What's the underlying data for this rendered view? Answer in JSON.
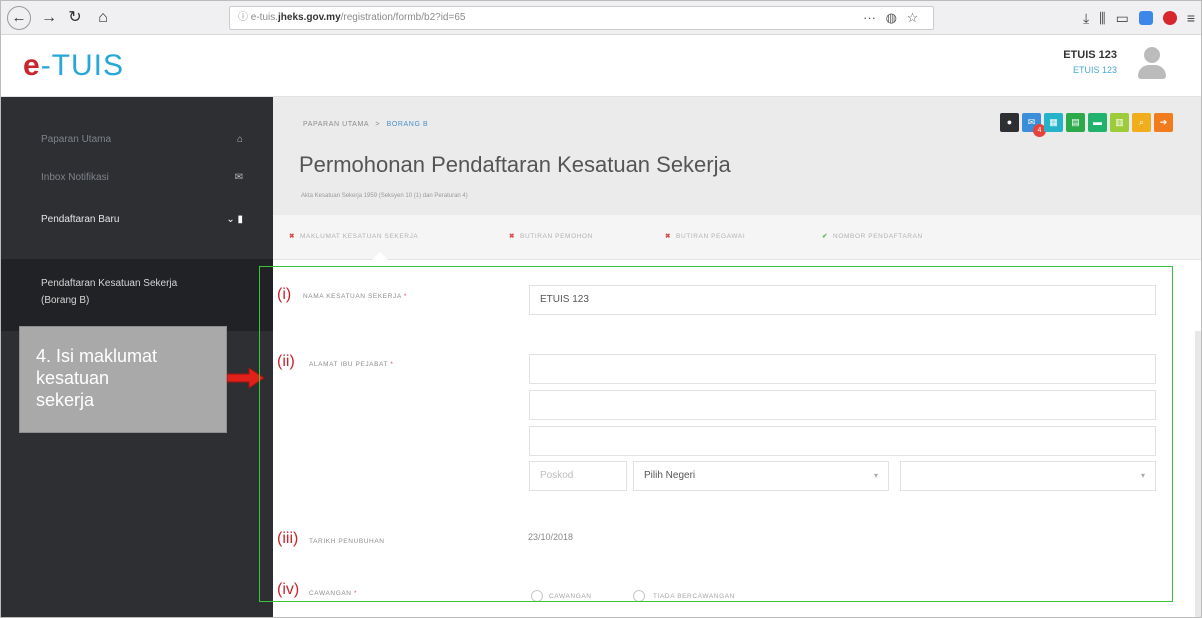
{
  "browser": {
    "url_prefix": "e-tuis.",
    "url_domain": "jheks.gov.my",
    "url_path": "/registration/formb/b2?id=65",
    "url_lock": "ⓘ"
  },
  "header": {
    "logo_e": "e",
    "logo_text": "-TUIS",
    "user_name": "ETUIS 123",
    "user_sub": "ETUIS 123"
  },
  "sidebar": {
    "items": [
      {
        "label": "Paparan Utama"
      },
      {
        "label": "Inbox Notifikasi"
      },
      {
        "label": "Pendaftaran Baru"
      }
    ],
    "sub_item_line1": "Pendaftaran Kesatuan Sekerja",
    "sub_item_line2": "(Borang B)"
  },
  "annotation": {
    "line1": "4. Isi maklumat",
    "line2": "kesatuan",
    "line3": "sekerja"
  },
  "page": {
    "breadcrumb_home": "PAPARAN UTAMA",
    "breadcrumb_sep": ">",
    "breadcrumb_current": "BORANG B",
    "title": "Permohonan Pendaftaran Kesatuan Sekerja",
    "subtitle": "Akta Kesatuan Sekerja 1959 (Seksyen 10 (1) dan Peraturan 4)",
    "notif_count": "4"
  },
  "tabs": [
    {
      "label": "MAKLUMAT KESATUAN SEKERJA",
      "status": "x"
    },
    {
      "label": "BUTIRAN PEMOHON",
      "status": "x"
    },
    {
      "label": "BUTIRAN PEGAWAI",
      "status": "x"
    },
    {
      "label": "NOMBOR PENDAFTARAN",
      "status": "ok"
    }
  ],
  "form": {
    "roman_i": "(i)",
    "roman_ii": "(ii)",
    "roman_iii": "(iii)",
    "roman_iv": "(iv)",
    "name_label": "NAMA KESATUAN SEKERJA",
    "name_value": "ETUIS 123",
    "address_label": "ALAMAT IBU PEJABAT",
    "postcode_placeholder": "Poskod",
    "state_select": "Pilih Negeri",
    "date_label": "TARIKH PENUBUHAN",
    "date_value": "23/10/2018",
    "cawangan_label": "CAWANGAN",
    "radio_yes": "CAWANGAN",
    "radio_no": "TIADA BERCAWANGAN",
    "required_mark": "*"
  },
  "colors": {
    "sidebar": "#2d2f33",
    "annotation_arrow": "#e0201a",
    "highlight_box": "#38c638",
    "btn_colors": [
      "#2d2f33",
      "#3a8fd8",
      "#26b3c9",
      "#2ca94b",
      "#21b36e",
      "#9dcb3a",
      "#f0ad1c",
      "#f07c1e"
    ]
  }
}
